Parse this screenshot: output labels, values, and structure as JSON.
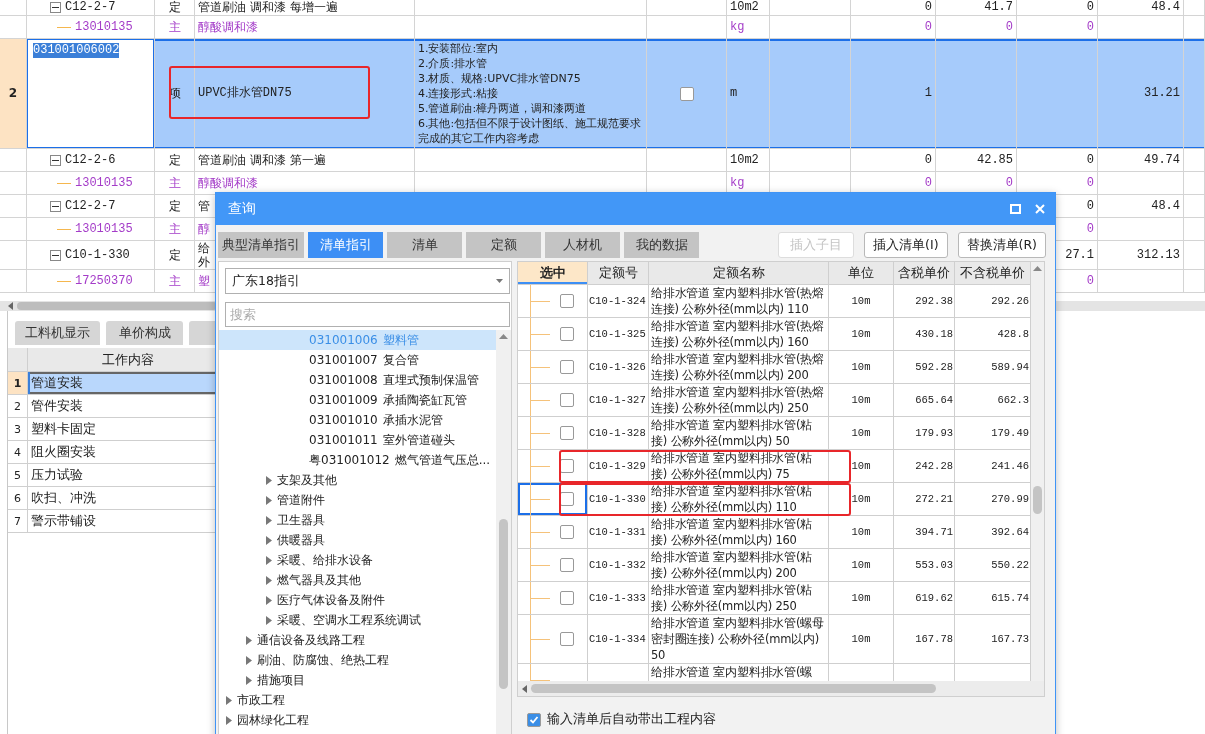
{
  "main_table": {
    "groups": [
      {
        "children": [
          {
            "kind": "quota",
            "code": "C12-2-7",
            "expanded": true,
            "type": "定",
            "name": "管道刷油 调和漆 每增一遍",
            "unit": "10m2",
            "qty": "0",
            "col_9": "41.7",
            "col_10": "0",
            "col_11": "48.4",
            "children": [
              {
                "kind": "material",
                "code": "13010135",
                "type": "主",
                "name": "醇酸调和漆",
                "unit": "kg",
                "qty": "0",
                "col_9": "0",
                "col_10": "0"
              }
            ]
          }
        ]
      },
      {
        "kind": "item",
        "row_number": "2",
        "selected": true,
        "code": "031001006002",
        "type": "项",
        "name": "UPVC排水管DN75",
        "highlighted": true,
        "features": [
          "1.安装部位:室内",
          "2.介质:排水管",
          "3.材质、规格:UPVC排水管DN75",
          "4.连接形式:粘接",
          "5.管道刷油:樟丹两道，调和漆两道",
          "6.其他:包括但不限于设计图纸、施工规范要求完成的其它工作内容考虑"
        ],
        "checked": false,
        "unit": "m",
        "qty": "1",
        "col_11": "31.21",
        "children": [
          {
            "kind": "quota",
            "code": "C12-2-6",
            "expanded": true,
            "type": "定",
            "name": "管道刷油 调和漆 第一遍",
            "unit": "10m2",
            "qty": "0",
            "col_9": "42.85",
            "col_10": "0",
            "col_11": "49.74",
            "children": [
              {
                "kind": "material",
                "code": "13010135",
                "type": "主",
                "name": "醇酸调和漆",
                "unit": "kg",
                "qty": "0",
                "col_9": "0",
                "col_10": "0"
              }
            ]
          },
          {
            "kind": "quota",
            "code": "C12-2-7",
            "expanded": true,
            "type": "定",
            "name": "管",
            "col_10": "0",
            "col_11": "48.4",
            "children": [
              {
                "kind": "material",
                "code": "13010135",
                "type": "主",
                "name": "醇",
                "col_10": "0"
              }
            ]
          },
          {
            "kind": "quota",
            "code": "C10-1-330",
            "expanded": true,
            "type": "定",
            "name_lines": [
              "给",
              "外"
            ],
            "col_10": "27.1",
            "col_11": "312.13",
            "children": [
              {
                "kind": "material",
                "code": "17250370",
                "type": "主",
                "name": "塑",
                "col_10": "0"
              }
            ]
          }
        ]
      }
    ]
  },
  "detail_panel": {
    "tabs": [
      {
        "label": "工料机显示",
        "selected": false
      },
      {
        "label": "单价构成",
        "selected": false
      },
      {
        "selected": false
      }
    ],
    "work_content": {
      "column": "工作内容",
      "rows": [
        {
          "number": "1",
          "text": "管道安装",
          "selected": true
        },
        {
          "number": "2",
          "text": "管件安装",
          "selected": false
        },
        {
          "number": "3",
          "text": "塑料卡固定",
          "selected": false
        },
        {
          "number": "4",
          "text": "阻火圈安装",
          "selected": false
        },
        {
          "number": "5",
          "text": "压力试验",
          "selected": false
        },
        {
          "number": "6",
          "text": "吹扫、冲洗",
          "selected": false
        },
        {
          "number": "7",
          "text": "警示带铺设",
          "selected": false
        }
      ]
    }
  },
  "query_dialog": {
    "title": "查询",
    "tabs": [
      {
        "label": "典型清单指引",
        "selected": false
      },
      {
        "label": "清单指引",
        "selected": true
      },
      {
        "label": "清单",
        "selected": false
      },
      {
        "label": "定额",
        "selected": false
      },
      {
        "label": "人材机",
        "selected": false
      },
      {
        "label": "我的数据",
        "selected": false
      }
    ],
    "buttons": [
      {
        "label": "插入子目",
        "disabled": true
      },
      {
        "label": "插入清单(I)",
        "disabled": false
      },
      {
        "label": "替换清单(R)",
        "disabled": false
      }
    ],
    "guide_select": {
      "value": "广东18指引"
    },
    "search": {
      "placeholder": "搜索"
    },
    "tree": [
      {
        "children": [
          {
            "children": [
              {
                "children": [
                  {
                    "code": "031001006",
                    "label": "塑料管",
                    "selected": true
                  },
                  {
                    "code": "031001007",
                    "label": "复合管",
                    "selected": false
                  },
                  {
                    "code": "031001008",
                    "label": "直埋式预制保温管",
                    "selected": false
                  },
                  {
                    "code": "031001009",
                    "label": "承插陶瓷缸瓦管",
                    "selected": false
                  },
                  {
                    "code": "031001010",
                    "label": "承插水泥管",
                    "selected": false
                  },
                  {
                    "code": "031001011",
                    "label": "室外管道碰头",
                    "selected": false
                  },
                  {
                    "code": "粤031001012",
                    "label": "燃气管道气压总...",
                    "selected": false
                  }
                ]
              },
              {
                "label": "支架及其他",
                "expanded": false,
                "selected": false
              },
              {
                "label": "管道附件",
                "expanded": false,
                "selected": false
              },
              {
                "label": "卫生器具",
                "expanded": false,
                "selected": false
              },
              {
                "label": "供暖器具",
                "expanded": false,
                "selected": false
              },
              {
                "label": "采暖、给排水设备",
                "expanded": false,
                "selected": false
              },
              {
                "label": "燃气器具及其他",
                "expanded": false,
                "selected": false
              },
              {
                "label": "医疗气体设备及附件",
                "expanded": false,
                "selected": false
              },
              {
                "label": "采暖、空调水工程系统调试",
                "expanded": false,
                "selected": false
              }
            ]
          },
          {
            "label": "通信设备及线路工程",
            "expanded": false,
            "selected": false
          },
          {
            "label": "刷油、防腐蚀、绝热工程",
            "expanded": false,
            "selected": false
          },
          {
            "label": "措施项目",
            "expanded": false,
            "selected": false
          }
        ]
      },
      {
        "label": "市政工程",
        "expanded": false,
        "selected": false
      },
      {
        "label": "园林绿化工程",
        "expanded": false,
        "selected": false
      }
    ],
    "results": {
      "columns": [
        "选中",
        "定额号",
        "定额名称",
        "单位",
        "含税单价",
        "不含税单价"
      ],
      "rows": [
        {
          "checked": false,
          "code": "C10-1-324",
          "name": "给排水管道 室内塑料排水管(热熔连接) 公称外径(mm以内) 110",
          "unit": "10m",
          "price_tax": "292.38",
          "price_net": "292.26",
          "highlighted": false,
          "focused": false
        },
        {
          "checked": false,
          "code": "C10-1-325",
          "name": "给排水管道 室内塑料排水管(热熔连接) 公称外径(mm以内) 160",
          "unit": "10m",
          "price_tax": "430.18",
          "price_net": "428.8",
          "highlighted": false,
          "focused": false
        },
        {
          "checked": false,
          "code": "C10-1-326",
          "name": "给排水管道 室内塑料排水管(热熔连接) 公称外径(mm以内) 200",
          "unit": "10m",
          "price_tax": "592.28",
          "price_net": "589.94",
          "highlighted": false,
          "focused": false
        },
        {
          "checked": false,
          "code": "C10-1-327",
          "name": "给排水管道 室内塑料排水管(热熔连接) 公称外径(mm以内) 250",
          "unit": "10m",
          "price_tax": "665.64",
          "price_net": "662.3",
          "highlighted": false,
          "focused": false
        },
        {
          "checked": false,
          "code": "C10-1-328",
          "name": "给排水管道 室内塑料排水管(粘接) 公称外径(mm以内) 50",
          "unit": "10m",
          "price_tax": "179.93",
          "price_net": "179.49",
          "highlighted": false,
          "focused": false
        },
        {
          "checked": false,
          "code": "C10-1-329",
          "name": "给排水管道 室内塑料排水管(粘接) 公称外径(mm以内) 75",
          "unit": "10m",
          "price_tax": "242.28",
          "price_net": "241.46",
          "highlighted": true,
          "focused": false
        },
        {
          "checked": false,
          "code": "C10-1-330",
          "name": "给排水管道 室内塑料排水管(粘接) 公称外径(mm以内) 110",
          "unit": "10m",
          "price_tax": "272.21",
          "price_net": "270.99",
          "highlighted": true,
          "focused": true
        },
        {
          "checked": false,
          "code": "C10-1-331",
          "name": "给排水管道 室内塑料排水管(粘接) 公称外径(mm以内) 160",
          "unit": "10m",
          "price_tax": "394.71",
          "price_net": "392.64",
          "highlighted": false,
          "focused": false
        },
        {
          "checked": false,
          "code": "C10-1-332",
          "name": "给排水管道 室内塑料排水管(粘接) 公称外径(mm以内) 200",
          "unit": "10m",
          "price_tax": "553.03",
          "price_net": "550.22",
          "highlighted": false,
          "focused": false
        },
        {
          "checked": false,
          "code": "C10-1-333",
          "name": "给排水管道 室内塑料排水管(粘接) 公称外径(mm以内) 250",
          "unit": "10m",
          "price_tax": "619.62",
          "price_net": "615.74",
          "highlighted": false,
          "focused": false
        },
        {
          "checked": false,
          "code": "C10-1-334",
          "name": "给排水管道 室内塑料排水管(螺母密封圈连接) 公称外径(mm以内) 50",
          "unit": "10m",
          "price_tax": "167.78",
          "price_net": "167.73",
          "highlighted": false,
          "focused": false
        },
        {
          "name": "给排水管道 室内塑料排水管(螺",
          "highlighted": false,
          "focused": false
        }
      ]
    },
    "auto_fill": {
      "label": "输入清单后自动带出工程内容",
      "checked": true
    }
  }
}
